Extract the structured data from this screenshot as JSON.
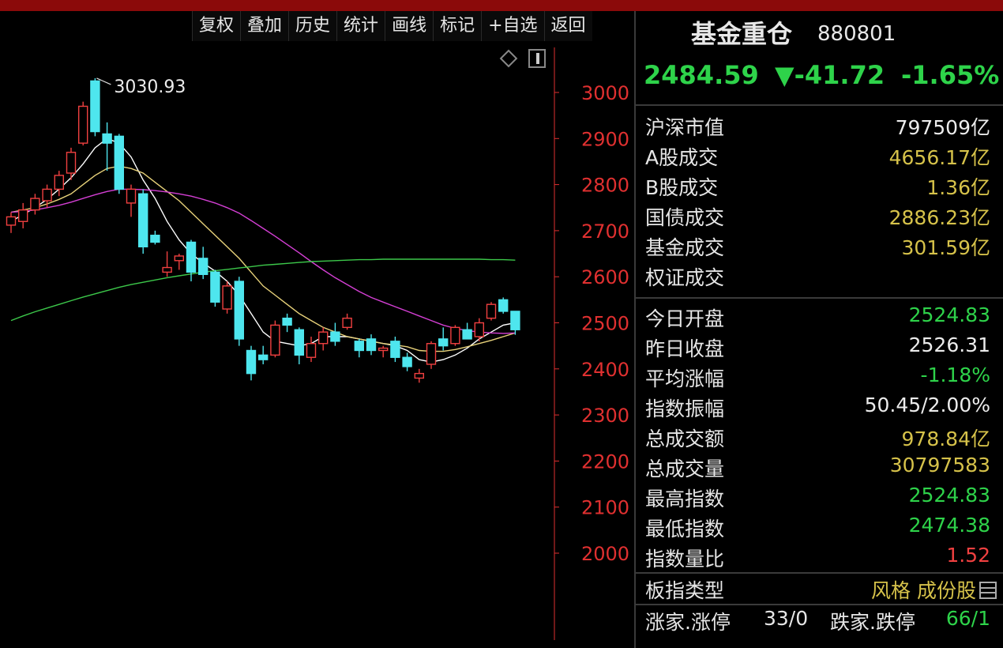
{
  "toolbar": {
    "buttons": [
      "复权",
      "叠加",
      "历史",
      "统计",
      "画线",
      "标记",
      "+自选",
      "返回"
    ]
  },
  "colors": {
    "up": "#f04040",
    "down": "#4ee6ee",
    "ma5": "#ffffff",
    "ma10": "#e8d27a",
    "ma20": "#d43fd4",
    "ma60": "#3cc84a",
    "axis": "#e03030"
  },
  "chart_data": {
    "type": "candlestick",
    "y_ticks": [
      3000,
      2900,
      2800,
      2700,
      2600,
      2500,
      2400,
      2300,
      2200,
      2100,
      2000
    ],
    "ylim": [
      1950,
      3060
    ],
    "annotation": "3030.93",
    "candles": [
      {
        "o": 2712,
        "h": 2740,
        "l": 2695,
        "c": 2730
      },
      {
        "o": 2720,
        "h": 2760,
        "l": 2705,
        "c": 2745
      },
      {
        "o": 2745,
        "h": 2780,
        "l": 2735,
        "c": 2770
      },
      {
        "o": 2765,
        "h": 2800,
        "l": 2750,
        "c": 2790
      },
      {
        "o": 2790,
        "h": 2830,
        "l": 2775,
        "c": 2820
      },
      {
        "o": 2825,
        "h": 2880,
        "l": 2810,
        "c": 2870
      },
      {
        "o": 2890,
        "h": 2980,
        "l": 2885,
        "c": 2970
      },
      {
        "o": 3025,
        "h": 3031,
        "l": 2905,
        "c": 2915
      },
      {
        "o": 2910,
        "h": 2935,
        "l": 2830,
        "c": 2890
      },
      {
        "o": 2905,
        "h": 2910,
        "l": 2780,
        "c": 2790
      },
      {
        "o": 2760,
        "h": 2800,
        "l": 2730,
        "c": 2790
      },
      {
        "o": 2780,
        "h": 2790,
        "l": 2650,
        "c": 2665
      },
      {
        "o": 2690,
        "h": 2700,
        "l": 2670,
        "c": 2675
      },
      {
        "o": 2610,
        "h": 2655,
        "l": 2600,
        "c": 2620
      },
      {
        "o": 2635,
        "h": 2650,
        "l": 2615,
        "c": 2645
      },
      {
        "o": 2675,
        "h": 2680,
        "l": 2590,
        "c": 2610
      },
      {
        "o": 2640,
        "h": 2665,
        "l": 2595,
        "c": 2605
      },
      {
        "o": 2610,
        "h": 2615,
        "l": 2535,
        "c": 2545
      },
      {
        "o": 2530,
        "h": 2590,
        "l": 2520,
        "c": 2580
      },
      {
        "o": 2590,
        "h": 2600,
        "l": 2450,
        "c": 2465
      },
      {
        "o": 2440,
        "h": 2450,
        "l": 2375,
        "c": 2390
      },
      {
        "o": 2430,
        "h": 2450,
        "l": 2410,
        "c": 2420
      },
      {
        "o": 2430,
        "h": 2505,
        "l": 2425,
        "c": 2495
      },
      {
        "o": 2510,
        "h": 2520,
        "l": 2480,
        "c": 2495
      },
      {
        "o": 2485,
        "h": 2490,
        "l": 2410,
        "c": 2430
      },
      {
        "o": 2425,
        "h": 2470,
        "l": 2415,
        "c": 2455
      },
      {
        "o": 2455,
        "h": 2490,
        "l": 2440,
        "c": 2480
      },
      {
        "o": 2480,
        "h": 2500,
        "l": 2450,
        "c": 2460
      },
      {
        "o": 2490,
        "h": 2520,
        "l": 2485,
        "c": 2510
      },
      {
        "o": 2460,
        "h": 2465,
        "l": 2425,
        "c": 2440
      },
      {
        "o": 2465,
        "h": 2475,
        "l": 2430,
        "c": 2440
      },
      {
        "o": 2440,
        "h": 2450,
        "l": 2425,
        "c": 2445
      },
      {
        "o": 2460,
        "h": 2470,
        "l": 2415,
        "c": 2425
      },
      {
        "o": 2425,
        "h": 2435,
        "l": 2395,
        "c": 2405
      },
      {
        "o": 2380,
        "h": 2400,
        "l": 2370,
        "c": 2390
      },
      {
        "o": 2410,
        "h": 2460,
        "l": 2400,
        "c": 2455
      },
      {
        "o": 2465,
        "h": 2490,
        "l": 2440,
        "c": 2450
      },
      {
        "o": 2455,
        "h": 2495,
        "l": 2450,
        "c": 2490
      },
      {
        "o": 2485,
        "h": 2500,
        "l": 2465,
        "c": 2465
      },
      {
        "o": 2470,
        "h": 2510,
        "l": 2460,
        "c": 2500
      },
      {
        "o": 2510,
        "h": 2545,
        "l": 2505,
        "c": 2540
      },
      {
        "o": 2550,
        "h": 2555,
        "l": 2520,
        "c": 2525
      },
      {
        "o": 2525,
        "h": 2525,
        "l": 2474,
        "c": 2485
      }
    ],
    "ma_series": [
      {
        "key": "ma5",
        "values": [
          2720,
          2735,
          2750,
          2768,
          2790,
          2815,
          2845,
          2880,
          2900,
          2890,
          2860,
          2810,
          2770,
          2720,
          2680,
          2650,
          2630,
          2612,
          2590,
          2560,
          2520,
          2480,
          2460,
          2455,
          2450,
          2455,
          2470,
          2470,
          2470,
          2465,
          2460,
          2455,
          2450,
          2440,
          2420,
          2415,
          2420,
          2430,
          2445,
          2465,
          2480,
          2495,
          2500
        ]
      },
      {
        "key": "ma10",
        "values": [
          2740,
          2745,
          2750,
          2758,
          2768,
          2780,
          2800,
          2820,
          2835,
          2840,
          2835,
          2825,
          2805,
          2785,
          2765,
          2740,
          2715,
          2690,
          2665,
          2640,
          2610,
          2580,
          2560,
          2540,
          2520,
          2505,
          2490,
          2480,
          2470,
          2465,
          2460,
          2455,
          2452,
          2448,
          2440,
          2438,
          2438,
          2442,
          2448,
          2455,
          2462,
          2470,
          2478
        ]
      },
      {
        "key": "ma20",
        "values": [
          2740,
          2742,
          2745,
          2750,
          2755,
          2762,
          2770,
          2778,
          2785,
          2790,
          2790,
          2789,
          2787,
          2784,
          2780,
          2775,
          2768,
          2760,
          2750,
          2738,
          2722,
          2705,
          2688,
          2670,
          2652,
          2633,
          2615,
          2598,
          2583,
          2568,
          2555,
          2545,
          2535,
          2525,
          2515,
          2505,
          2495,
          2488,
          2483,
          2480,
          2478,
          2477,
          2478
        ]
      },
      {
        "key": "ma60",
        "values": [
          2505,
          2515,
          2524,
          2532,
          2540,
          2548,
          2556,
          2563,
          2570,
          2577,
          2583,
          2588,
          2593,
          2598,
          2602,
          2606,
          2610,
          2613,
          2616,
          2619,
          2622,
          2625,
          2627,
          2629,
          2631,
          2633,
          2634,
          2635,
          2636,
          2637,
          2637,
          2638,
          2638,
          2638,
          2638,
          2638,
          2638,
          2638,
          2638,
          2638,
          2637,
          2637,
          2636
        ]
      }
    ]
  },
  "panel": {
    "title": "基金重仓",
    "code": "880801",
    "price": "2484.59",
    "change": "▼-41.72",
    "change_pct": "-1.65%",
    "rows_a": [
      {
        "label": "沪深市值",
        "value": "797509亿",
        "color": "white"
      },
      {
        "label": "A股成交",
        "value": "4656.17亿",
        "color": "yellow"
      },
      {
        "label": "B股成交",
        "value": "1.36亿",
        "color": "yellow"
      },
      {
        "label": "国债成交",
        "value": "2886.23亿",
        "color": "yellow"
      },
      {
        "label": "基金成交",
        "value": "301.59亿",
        "color": "yellow"
      },
      {
        "label": "权证成交",
        "value": "",
        "color": "yellow"
      }
    ],
    "rows_b": [
      {
        "label": "今日开盘",
        "value": "2524.83",
        "color": "green"
      },
      {
        "label": "昨日收盘",
        "value": "2526.31",
        "color": "white"
      },
      {
        "label": "平均涨幅",
        "value": "-1.18%",
        "color": "green"
      },
      {
        "label": "指数振幅",
        "value": "50.45/2.00%",
        "color": "white"
      },
      {
        "label": "总成交额",
        "value": "978.84亿",
        "color": "yellow"
      },
      {
        "label": "总成交量",
        "value": "30797583",
        "color": "yellow"
      },
      {
        "label": "最高指数",
        "value": "2524.83",
        "color": "green"
      },
      {
        "label": "最低指数",
        "value": "2474.38",
        "color": "green"
      },
      {
        "label": "指数量比",
        "value": "1.52",
        "color": "red"
      }
    ],
    "type_label": "板指类型",
    "type_value": "风格 成份股",
    "adv_label": "涨家.涨停",
    "adv_value": "33/0",
    "dec_label": "跌家.跌停",
    "dec_value": "66/1"
  }
}
